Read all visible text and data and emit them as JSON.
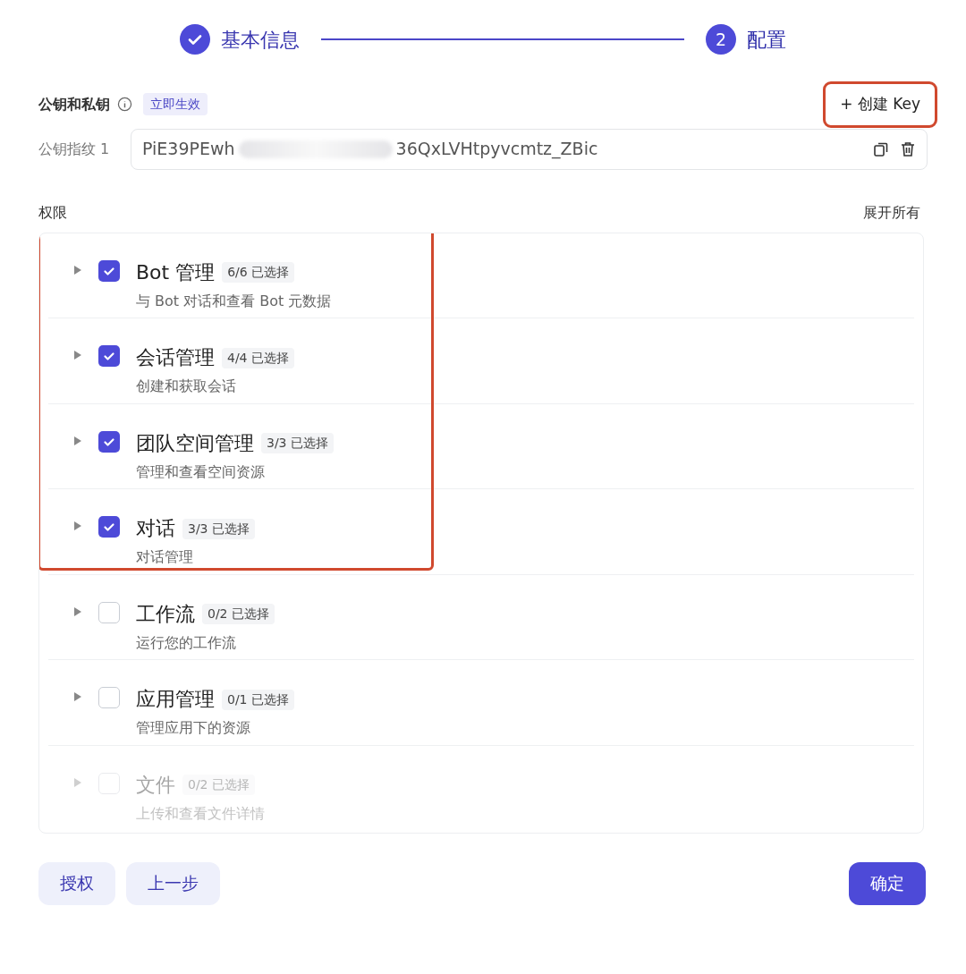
{
  "steps": [
    {
      "label": "基本信息",
      "done": true,
      "selected": false
    },
    {
      "label": "配置",
      "number": "2",
      "done": false,
      "selected": true
    }
  ],
  "keys": {
    "title": "公钥和私钥",
    "badge": "立即生效",
    "create_button": {
      "label": "+ 创建 Key",
      "highlighted": true
    },
    "fingerprints": [
      {
        "label": "公钥指纹 1",
        "value_start": "PiE39PEwh",
        "value_end": "36QxLVHtpyvcmtz_ZBic",
        "masked": true
      }
    ]
  },
  "permissions": {
    "title": "权限",
    "expand_all": "展开所有",
    "items": [
      {
        "name": "Bot 管理",
        "count": "6/6 已选择",
        "description": "与 Bot 对话和查看 Bot 元数据",
        "checked": true,
        "highlighted": true
      },
      {
        "name": "会话管理",
        "count": "4/4 已选择",
        "description": "创建和获取会话",
        "checked": true,
        "highlighted": true
      },
      {
        "name": "团队空间管理",
        "count": "3/3 已选择",
        "description": "管理和查看空间资源",
        "checked": true,
        "highlighted": true
      },
      {
        "name": "对话",
        "count": "3/3 已选择",
        "description": "对话管理",
        "checked": true,
        "highlighted": true
      },
      {
        "name": "工作流",
        "count": "0/2 已选择",
        "description": "运行您的工作流",
        "checked": false,
        "highlighted": false
      },
      {
        "name": "应用管理",
        "count": "0/1 已选择",
        "description": "管理应用下的资源",
        "checked": false,
        "highlighted": false
      },
      {
        "name": "文件",
        "count": "0/2 已选择",
        "description": "上传和查看文件详情",
        "checked": false,
        "highlighted": false
      }
    ]
  },
  "footer": {
    "buttons": [
      {
        "label": "授权",
        "kind": "secondary"
      },
      {
        "label": "上一步",
        "kind": "secondary"
      },
      {
        "label": "确定",
        "kind": "primary"
      }
    ]
  }
}
